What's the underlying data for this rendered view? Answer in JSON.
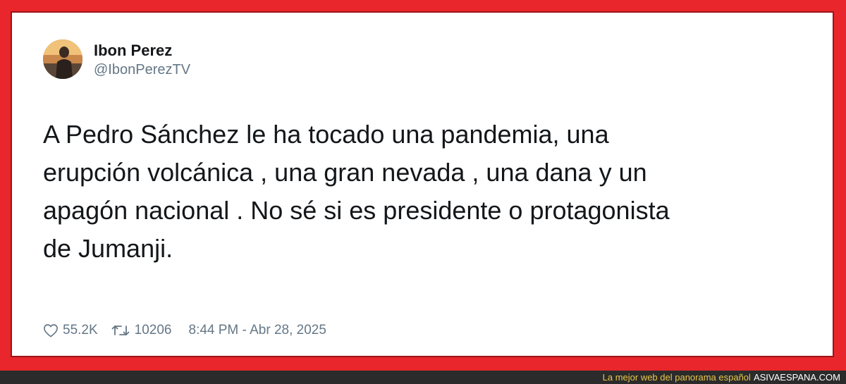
{
  "tweet": {
    "author_name": "Ibon Perez",
    "handle": "@IbonPerezTV",
    "text": "A Pedro Sánchez le ha tocado una pandemia, una\nerupción volcánica , una gran nevada , una dana y un\napagón nacional . No sé si es presidente o protagonista\nde Jumanji.",
    "likes": "55.2K",
    "retweets": "10206",
    "timestamp": "8:44 PM - Abr 28, 2025"
  },
  "footer": {
    "slogan": "La mejor web del panorama español",
    "site": "ASIVAESPANA.COM"
  },
  "colors": {
    "frame": "#e8262b",
    "frame_border": "#9b1418",
    "footer_bg": "#2b2b2b",
    "slogan": "#e8c64a",
    "muted_text": "#657786"
  },
  "icons": {
    "like": "heart-outline-icon",
    "retweet": "retweet-icon"
  }
}
